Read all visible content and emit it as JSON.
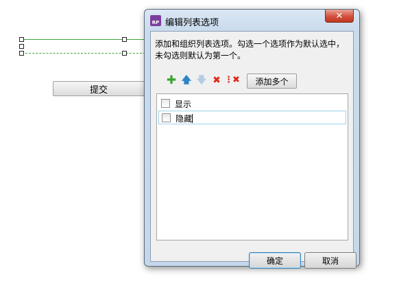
{
  "canvas": {
    "submit_label": "提交"
  },
  "dialog": {
    "title": "编辑列表选项",
    "app_icon_text": "RP",
    "close_glyph": "✕",
    "description": "添加和组织列表选项。勾选一个选项作为默认选中，未勾选则默认为第一个。",
    "toolbar": {
      "add_icon": "plus-icon",
      "up_icon": "arrow-up-icon",
      "down_icon": "arrow-down-icon",
      "delete_icon": "delete-icon",
      "delete_all_icon": "delete-all-icon",
      "add_many_label": "添加多个"
    },
    "items": [
      {
        "label": "显示",
        "checked": false
      },
      {
        "label": "隐藏",
        "checked": false
      }
    ],
    "ok_label": "确定",
    "cancel_label": "取消"
  },
  "colors": {
    "add": "#3aa533",
    "up": "#2b86c6",
    "delete": "#e0261b",
    "selection_border": "#9bd2ea"
  }
}
